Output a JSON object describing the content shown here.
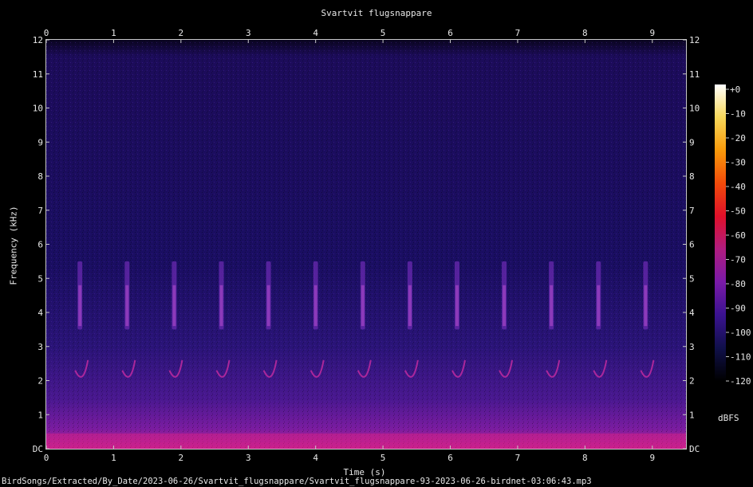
{
  "chart_data": {
    "type": "heatmap",
    "title": "Svartvit flugsnappare",
    "xlabel": "Time (s)",
    "ylabel": "Frequency (kHz)",
    "xlim": [
      0,
      9.5
    ],
    "ylim": [
      0,
      12
    ],
    "x_ticks": [
      "0",
      "1",
      "2",
      "3",
      "4",
      "5",
      "6",
      "7",
      "8",
      "9"
    ],
    "y_ticks": [
      "DC",
      "1",
      "2",
      "3",
      "4",
      "5",
      "6",
      "7",
      "8",
      "9",
      "10",
      "11",
      "12"
    ],
    "colorbar": {
      "label": "dBFS",
      "range": [
        -120,
        0
      ],
      "ticks": [
        "+0",
        "-10",
        "-20",
        "-30",
        "-40",
        "-50",
        "-60",
        "-70",
        "-80",
        "-90",
        "-100",
        "-110",
        "-120"
      ],
      "colors": [
        "#000000",
        "#10104a",
        "#3a1290",
        "#7a1aa8",
        "#b01c80",
        "#e0102a",
        "#f24a0a",
        "#f99a0a",
        "#f8d85a",
        "#ffffff"
      ]
    },
    "song_phrase_times_s": [
      0.5,
      1.2,
      1.9,
      2.6,
      3.3,
      4.0,
      4.7,
      5.4,
      6.1,
      6.8,
      7.5,
      8.2,
      8.9
    ],
    "song_band_khz": [
      3.5,
      5.5
    ],
    "filepath": "BirdSongs/Extracted/By_Date/2023-06-26/Svartvit_flugsnappare/Svartvit_flugsnappare-93-2023-06-26-birdnet-03:06:43.mp3"
  }
}
